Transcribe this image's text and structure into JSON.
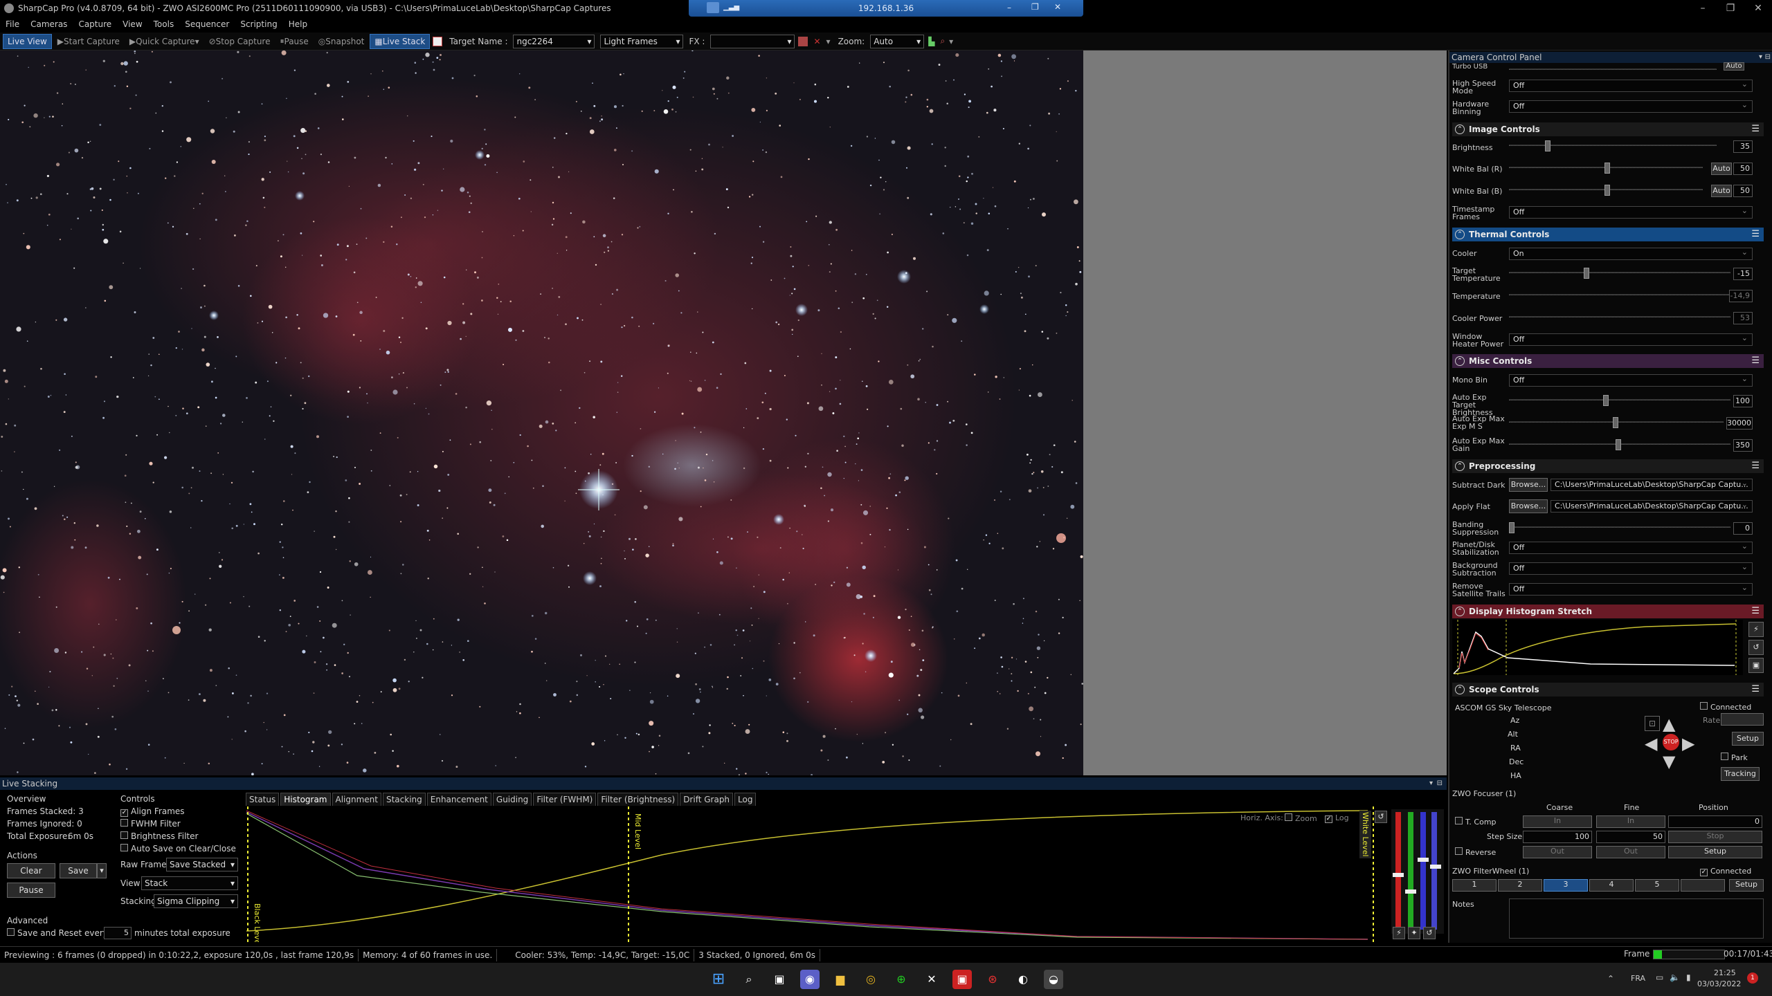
{
  "titlebar": {
    "title": "SharpCap Pro (v4.0.8709, 64 bit) - ZWO ASI2600MC Pro (2511D60111090900, via USB3) - C:\\Users\\PrimaLuceLab\\Desktop\\SharpCap Captures",
    "remote_ip": "192.168.1.36"
  },
  "menu": [
    "File",
    "Cameras",
    "Capture",
    "View",
    "Tools",
    "Sequencer",
    "Scripting",
    "Help"
  ],
  "toolbar": {
    "live_view": "Live View",
    "start_capture": "Start Capture",
    "quick_capture": "Quick Capture",
    "stop_capture": "Stop Capture",
    "pause": "Pause",
    "snapshot": "Snapshot",
    "live_stack": "Live Stack",
    "target_name_label": "Target Name :",
    "target_name": "ngc2264",
    "frame_type": "Light Frames",
    "fx_label": "FX :",
    "fx_value": "",
    "zoom_label": "Zoom:",
    "zoom_value": "Auto"
  },
  "panel": {
    "title": "Camera Control Panel",
    "top_rows": [
      {
        "label": "Turbo USB",
        "value": "Auto"
      },
      {
        "label": "High Speed Mode",
        "value": "Off"
      },
      {
        "label": "Hardware Binning",
        "value": "Off"
      }
    ],
    "image_controls": {
      "title": "Image Controls",
      "brightness_label": "Brightness",
      "brightness": "35",
      "wb_r_label": "White Bal (R)",
      "wb_r": "50",
      "wb_b_label": "White Bal (B)",
      "wb_b": "50",
      "auto": "Auto",
      "timestamp_label": "Timestamp Frames",
      "timestamp": "Off"
    },
    "thermal": {
      "title": "Thermal Controls",
      "cooler_label": "Cooler",
      "cooler": "On",
      "target_label": "Target Temperature",
      "target": "-15",
      "temp_label": "Temperature",
      "temp": "-14,9",
      "power_label": "Cooler Power",
      "power": "53",
      "heater_label": "Window Heater Power",
      "heater": "Off"
    },
    "misc": {
      "title": "Misc Controls",
      "mono_label": "Mono Bin",
      "mono": "Off",
      "aetb_label": "Auto Exp Target Brightness",
      "aetb": "100",
      "aeme_label": "Auto Exp Max Exp M S",
      "aeme": "30000",
      "aemg_label": "Auto Exp Max Gain",
      "aemg": "350"
    },
    "pre": {
      "title": "Preprocessing",
      "dark_label": "Subtract Dark",
      "flat_label": "Apply Flat",
      "browse": "Browse...",
      "dark_path": "C:\\Users\\PrimaLuceLab\\Desktop\\SharpCap Captu...",
      "flat_path": "C:\\Users\\PrimaLuceLab\\Desktop\\SharpCap Captu...",
      "banding_label": "Banding Suppression",
      "banding": "0",
      "stab_label": "Planet/Disk Stabilization",
      "stab": "Off",
      "bg_label": "Background Subtraction",
      "bg": "Off",
      "sat_label": "Remove Satellite Trails",
      "sat": "Off"
    },
    "hist": {
      "title": "Display Histogram Stretch"
    },
    "scope": {
      "title": "Scope Controls",
      "name": "ASCOM GS Sky Telescope",
      "connected": "Connected",
      "axes": [
        "Az",
        "Alt",
        "RA",
        "Dec",
        "HA"
      ],
      "rate": "Rate:",
      "setup": "Setup",
      "park": "Park",
      "tracking": "Tracking",
      "stop": "STOP"
    },
    "focuser": {
      "title": "ZWO Focuser (1)",
      "coarse": "Coarse",
      "fine": "Fine",
      "position": "Position",
      "tcomp": "T. Comp",
      "in": "In",
      "out": "Out",
      "pos_value": "0",
      "stop": "Stop",
      "step_label": "Step Size",
      "step_coarse": "100",
      "step_fine": "50",
      "reverse": "Reverse",
      "setup": "Setup"
    },
    "filter": {
      "title": "ZWO FilterWheel (1)",
      "connected": "Connected",
      "slots": [
        "1",
        "2",
        "3",
        "4",
        "5"
      ],
      "setup": "Setup",
      "notes": "Notes"
    }
  },
  "livestack": {
    "title": "Live Stacking",
    "overview": "Overview",
    "frames_stacked": "Frames Stacked: 3",
    "frames_ignored": "Frames Ignored: 0",
    "total_exposure": "Total Exposure:",
    "total_exposure_val": "6m 0s",
    "actions": "Actions",
    "clear": "Clear",
    "save": "Save",
    "pause": "Pause",
    "advanced": "Advanced",
    "save_reset": "Save and Reset every",
    "minutes": "5",
    "minutes_label": "minutes total exposure",
    "controls": "Controls",
    "align": "Align Frames",
    "fwhm": "FWHM Filter",
    "brightness": "Brightness Filter",
    "autosave": "Auto Save on Clear/Close",
    "raw_label": "Raw Frames",
    "raw": "Save Stacked",
    "view_label": "View",
    "view": "Stack",
    "stacking_label": "Stacking",
    "stacking": "Sigma Clipping",
    "tabs": [
      "Status",
      "Histogram",
      "Alignment",
      "Stacking",
      "Enhancement",
      "Guiding",
      "Filter (FWHM)",
      "Filter (Brightness)",
      "Drift Graph",
      "Log"
    ],
    "horiz_axis": "Horiz. Axis:",
    "zoom": "Zoom",
    "log": "Log",
    "black": "Black Level",
    "mid": "Mid Level",
    "white": "White Level"
  },
  "status": {
    "preview": "Previewing : 6 frames (0 dropped) in 0:10:22,2, exposure 120,0s , last frame 120,9s",
    "memory": "Memory: 4 of 60 frames in use.",
    "cooler": "Cooler: 53%, Temp: -14,9C, Target: -15,0C",
    "stacked": "3 Stacked, 0 Ignored, 6m 0s",
    "frame_label": "Frame :",
    "frame_time": "00:17/01:43"
  },
  "taskbar": {
    "lang": "FRA",
    "time": "21:25",
    "date": "03/03/2022"
  }
}
